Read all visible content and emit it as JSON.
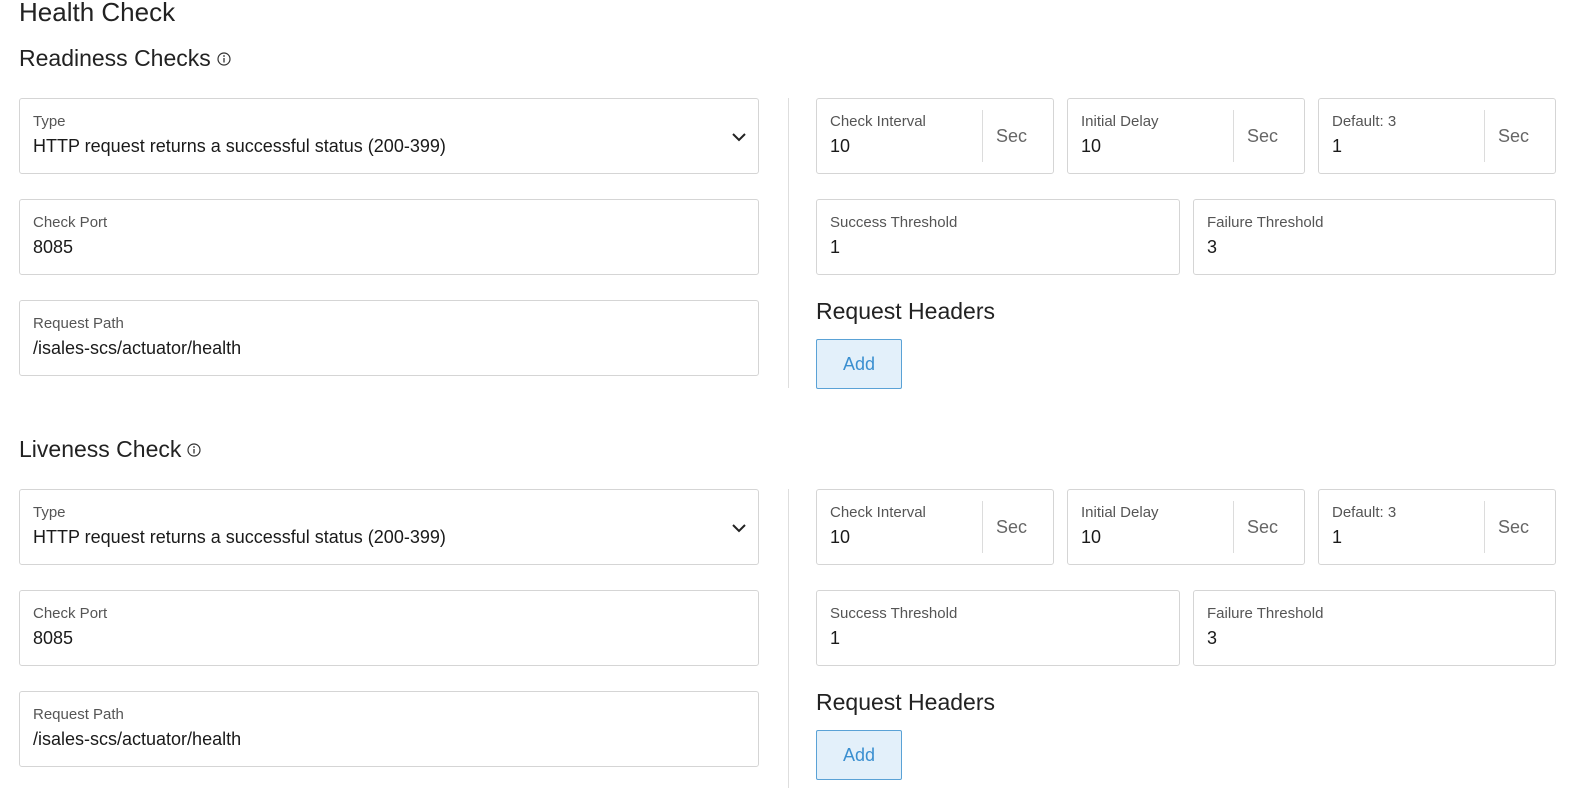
{
  "page": {
    "title": "Health Check"
  },
  "readiness": {
    "title": "Readiness Checks",
    "type_label": "Type",
    "type_value": "HTTP request returns a successful status (200-399)",
    "check_port_label": "Check Port",
    "check_port_value": "8085",
    "request_path_label": "Request Path",
    "request_path_value": "/isales-scs/actuator/health",
    "check_interval_label": "Check Interval",
    "check_interval_value": "10",
    "check_interval_unit": "Sec",
    "initial_delay_label": "Initial Delay",
    "initial_delay_value": "10",
    "initial_delay_unit": "Sec",
    "timeout_label": "Default: 3",
    "timeout_value": "1",
    "timeout_unit": "Sec",
    "success_threshold_label": "Success Threshold",
    "success_threshold_value": "1",
    "failure_threshold_label": "Failure Threshold",
    "failure_threshold_value": "3",
    "request_headers_title": "Request Headers",
    "add_label": "Add"
  },
  "liveness": {
    "title": "Liveness Check",
    "type_label": "Type",
    "type_value": "HTTP request returns a successful status (200-399)",
    "check_port_label": "Check Port",
    "check_port_value": "8085",
    "request_path_label": "Request Path",
    "request_path_value": "/isales-scs/actuator/health",
    "check_interval_label": "Check Interval",
    "check_interval_value": "10",
    "check_interval_unit": "Sec",
    "initial_delay_label": "Initial Delay",
    "initial_delay_value": "10",
    "initial_delay_unit": "Sec",
    "timeout_label": "Default: 3",
    "timeout_value": "1",
    "timeout_unit": "Sec",
    "success_threshold_label": "Success Threshold",
    "success_threshold_value": "1",
    "failure_threshold_label": "Failure Threshold",
    "failure_threshold_value": "3",
    "request_headers_title": "Request Headers",
    "add_label": "Add"
  },
  "icons": {
    "info": "info-icon",
    "dropdown": "chevron-down-icon"
  },
  "colors": {
    "accent": "#3a8fd0",
    "button_bg": "#e3f0fa",
    "border": "#d5d5d5"
  }
}
